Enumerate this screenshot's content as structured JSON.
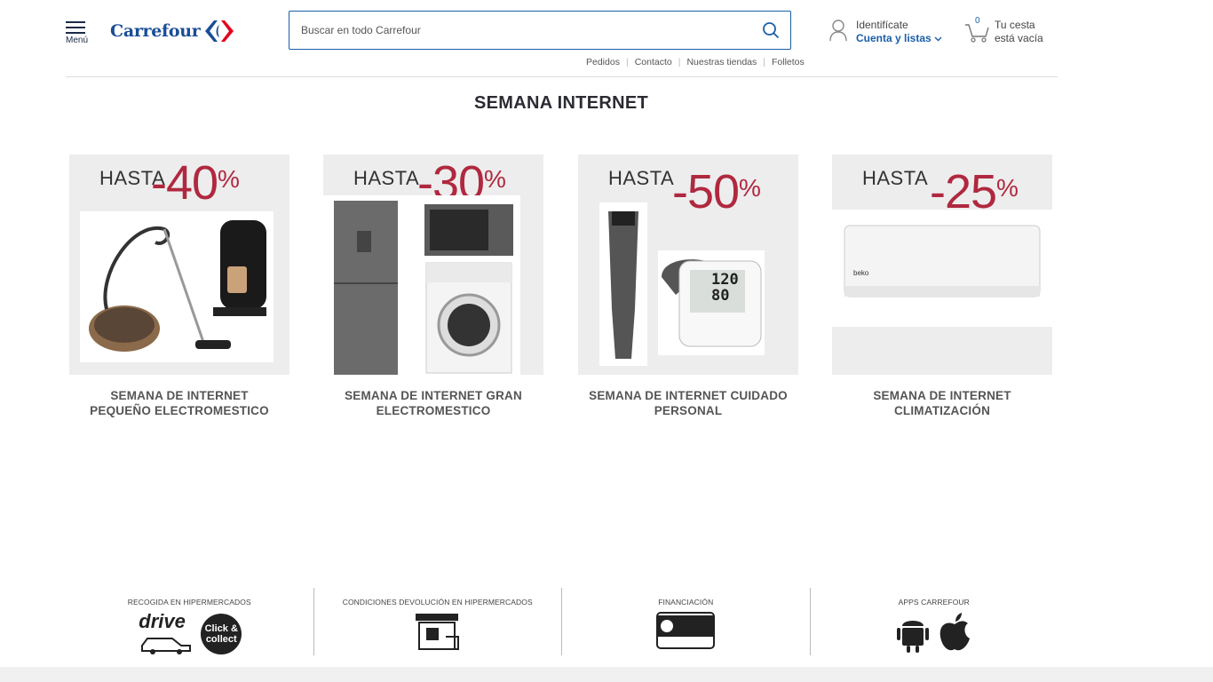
{
  "header": {
    "menu_label": "Menú",
    "logo_text": "Carrefour",
    "search_placeholder": "Buscar en todo Carrefour",
    "sublinks": [
      "Pedidos",
      "Contacto",
      "Nuestras tiendas",
      "Folletos"
    ],
    "account_line1": "Identifícate",
    "account_line2": "Cuenta y listas",
    "cart_count": "0",
    "cart_line1": "Tu cesta",
    "cart_line2": "está vacía",
    "brand_color": "#1a4d97",
    "accent_red": "#b0283f"
  },
  "main": {
    "title": "SEMANA INTERNET",
    "cards": [
      {
        "hasta": "HASTA",
        "discount": "-40",
        "percent": "%",
        "caption": "SEMANA DE INTERNET PEQUEÑO ELECTROMESTICO"
      },
      {
        "hasta": "HASTA",
        "discount": "-30",
        "percent": "%",
        "caption": "SEMANA DE INTERNET GRAN ELECTROMESTICO"
      },
      {
        "hasta": "HASTA",
        "discount": "-50",
        "percent": "%",
        "caption": "SEMANA DE INTERNET CUIDADO PERSONAL"
      },
      {
        "hasta": "HASTA",
        "discount": "-25",
        "percent": "%",
        "caption": "SEMANA DE INTERNET CLIMATIZACIÓN"
      }
    ],
    "blood_pressure_reading": [
      "120",
      "80"
    ]
  },
  "features": [
    {
      "title": "RECOGIDA EN HIPERMERCADOS",
      "icons": [
        "drive-icon",
        "click-and-collect-icon"
      ],
      "drive_text": "drive",
      "click_text": "Click & collect"
    },
    {
      "title": "CONDICIONES DEVOLUCIÓN EN HIPERMERCADOS",
      "icons": [
        "store-return-icon"
      ]
    },
    {
      "title": "FINANCIACIÓN",
      "icons": [
        "card-icon"
      ]
    },
    {
      "title": "APPS CARREFOUR",
      "icons": [
        "android-icon",
        "apple-icon"
      ]
    }
  ]
}
